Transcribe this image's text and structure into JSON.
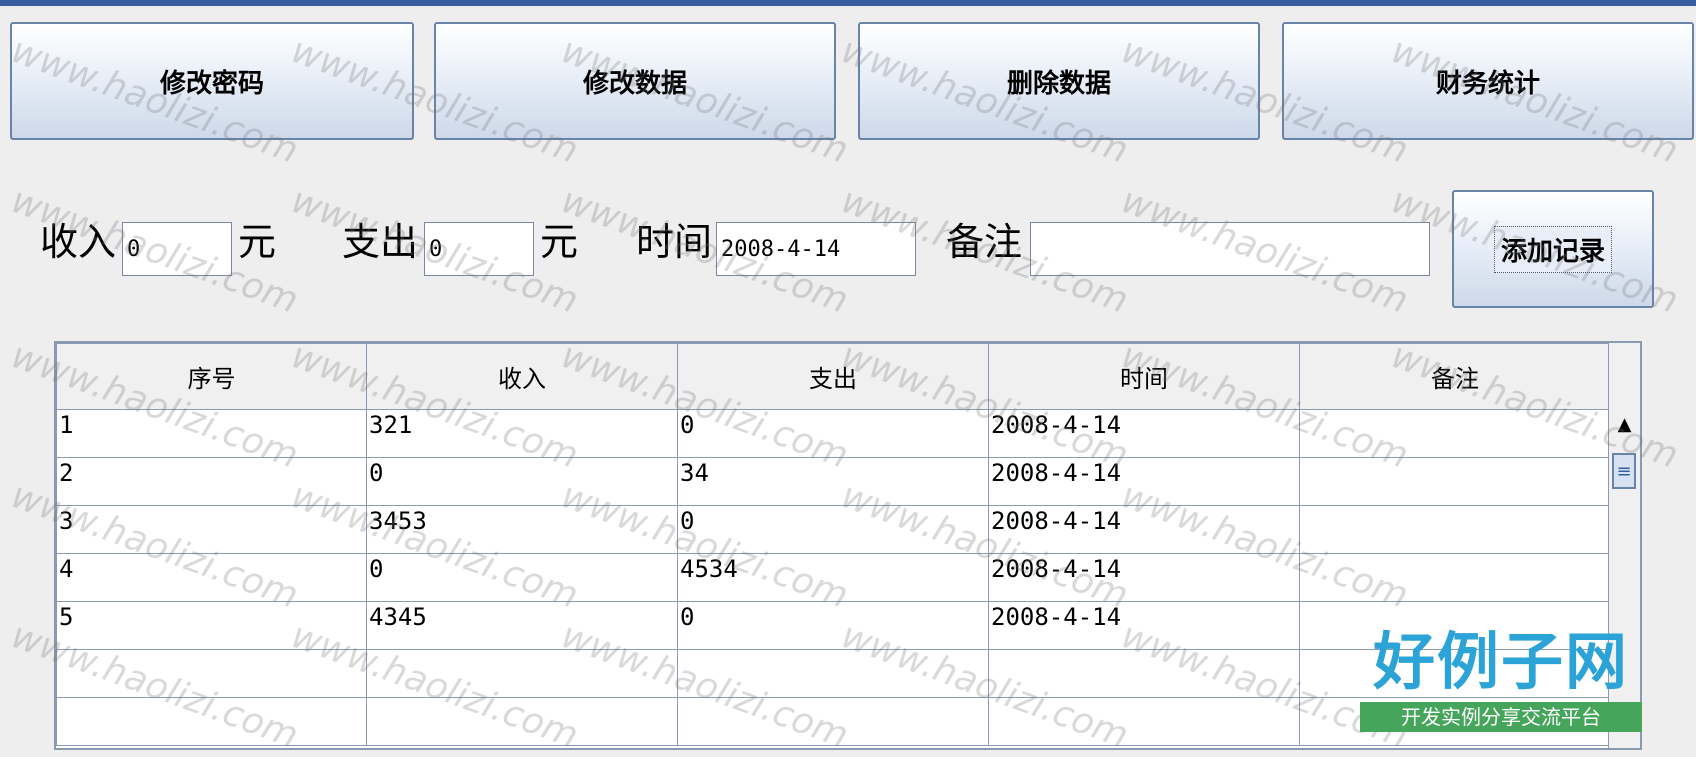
{
  "nav": {
    "change_password": "修改密码",
    "modify_data": "修改数据",
    "delete_data": "删除数据",
    "finance_stats": "财务统计"
  },
  "form": {
    "income_label": "收入",
    "income_value": "0",
    "income_unit": "元",
    "expense_label": "支出",
    "expense_value": "0",
    "expense_unit": "元",
    "time_label": "时间",
    "time_value": "2008-4-14",
    "note_label": "备注",
    "note_value": "",
    "add_button": "添加记录"
  },
  "table": {
    "headers": [
      "序号",
      "收入",
      "支出",
      "时间",
      "备注"
    ],
    "rows": [
      [
        "1",
        "321",
        "0",
        "2008-4-14",
        ""
      ],
      [
        "2",
        "0",
        "34",
        "2008-4-14",
        ""
      ],
      [
        "3",
        "3453",
        "0",
        "2008-4-14",
        ""
      ],
      [
        "4",
        "0",
        "4534",
        "2008-4-14",
        ""
      ],
      [
        "5",
        "4345",
        "0",
        "2008-4-14",
        ""
      ],
      [
        "",
        "",
        "",
        "",
        ""
      ],
      [
        "",
        "",
        "",
        "",
        ""
      ]
    ]
  },
  "scrollbar": {
    "up_glyph": "▲",
    "thumb_glyph": "≡"
  },
  "watermark": "www.haolizi.com",
  "logo": {
    "main": "好例子网",
    "sub": "开发实例分享交流平台"
  },
  "colors": {
    "title_bar": "#3a5da0",
    "logo_blue": "#2ca3d6",
    "logo_green": "#45a55a"
  }
}
